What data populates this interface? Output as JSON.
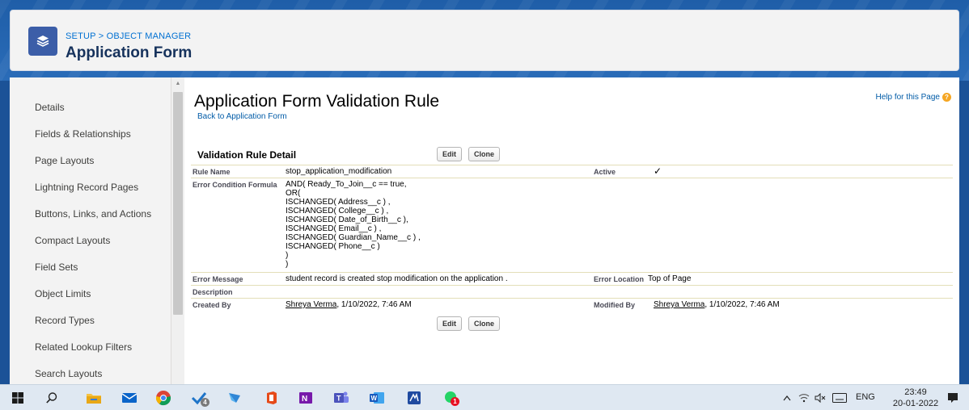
{
  "header": {
    "breadcrumb": "SETUP > OBJECT MANAGER",
    "title": "Application Form",
    "icon": "layers-icon"
  },
  "sidebar": {
    "items": [
      {
        "label": "Details"
      },
      {
        "label": "Fields & Relationships"
      },
      {
        "label": "Page Layouts"
      },
      {
        "label": "Lightning Record Pages"
      },
      {
        "label": "Buttons, Links, and Actions"
      },
      {
        "label": "Compact Layouts"
      },
      {
        "label": "Field Sets"
      },
      {
        "label": "Object Limits"
      },
      {
        "label": "Record Types"
      },
      {
        "label": "Related Lookup Filters"
      },
      {
        "label": "Search Layouts"
      }
    ]
  },
  "main": {
    "page_title": "Application Form Validation Rule",
    "back_link": "Back to Application Form",
    "help_link": "Help for this Page",
    "section_title": "Validation Rule Detail",
    "buttons": {
      "edit": "Edit",
      "clone": "Clone"
    },
    "fields": {
      "rule_name_label": "Rule Name",
      "rule_name_value": "stop_application_modification",
      "active_label": "Active",
      "active_value": "✓",
      "formula_label": "Error Condition Formula",
      "formula_lines": [
        "AND( Ready_To_Join__c == true,",
        "OR(",
        "ISCHANGED( Address__c ) ,",
        "ISCHANGED( College__c ) ,",
        "ISCHANGED( Date_of_Birth__c ),",
        "ISCHANGED( Email__c ) ,",
        "ISCHANGED( Guardian_Name__c ) ,",
        "ISCHANGED( Phone__c )",
        ")",
        ")"
      ],
      "error_message_label": "Error Message",
      "error_message_value": "student record is created stop modification on the application .",
      "error_location_label": "Error Location",
      "error_location_value": "Top of Page",
      "description_label": "Description",
      "created_by_label": "Created By",
      "created_by_user": "Shreya Verma",
      "created_by_date": ", 1/10/2022, 7:46 AM",
      "modified_by_label": "Modified By",
      "modified_by_user": "Shreya Verma",
      "modified_by_date": ", 1/10/2022, 7:46 AM"
    }
  },
  "taskbar": {
    "badges": {
      "vscode": "4",
      "whatsapp": "1"
    },
    "language": "ENG",
    "time": "23:49",
    "date": "20-01-2022"
  },
  "colors": {
    "brand_blue": "#1b5297",
    "link": "#015ba7",
    "header_icon": "#3c5ea8"
  }
}
